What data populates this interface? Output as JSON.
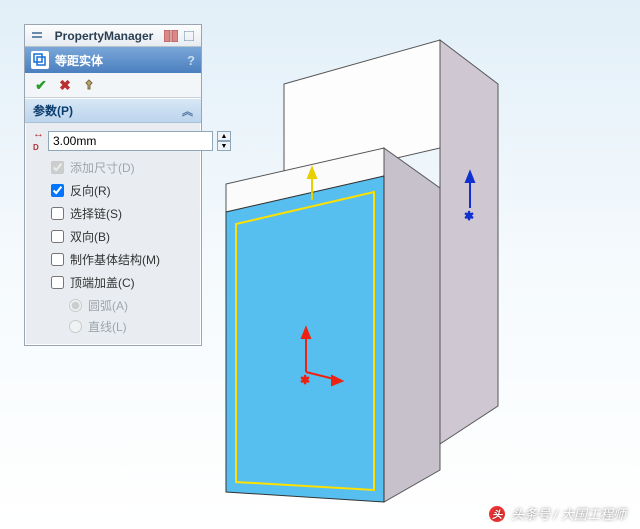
{
  "titlebar": {
    "title": "PropertyManager"
  },
  "feature": {
    "name": "等距实体"
  },
  "actions": {
    "ok": "✔",
    "cancel": "✖",
    "pin": "📌"
  },
  "params": {
    "header": "参数(P)",
    "distance_value": "3.00mm",
    "add_dim": "添加尺寸(D)",
    "reverse": "反向(R)",
    "select_chain": "选择链(S)",
    "bidirectional": "双向(B)",
    "base_construction": "制作基体结构(M)",
    "cap_ends": "顶端加盖(C)",
    "arc": "圆弧(A)",
    "line": "直线(L)"
  },
  "state": {
    "add_dim_checked": true,
    "reverse_checked": true,
    "select_chain_checked": false,
    "bidirectional_checked": false,
    "base_construction_checked": false,
    "cap_ends_checked": false,
    "arc_selected": true,
    "line_selected": false
  },
  "watermark": {
    "text": "头条号 / 大国工程师"
  }
}
